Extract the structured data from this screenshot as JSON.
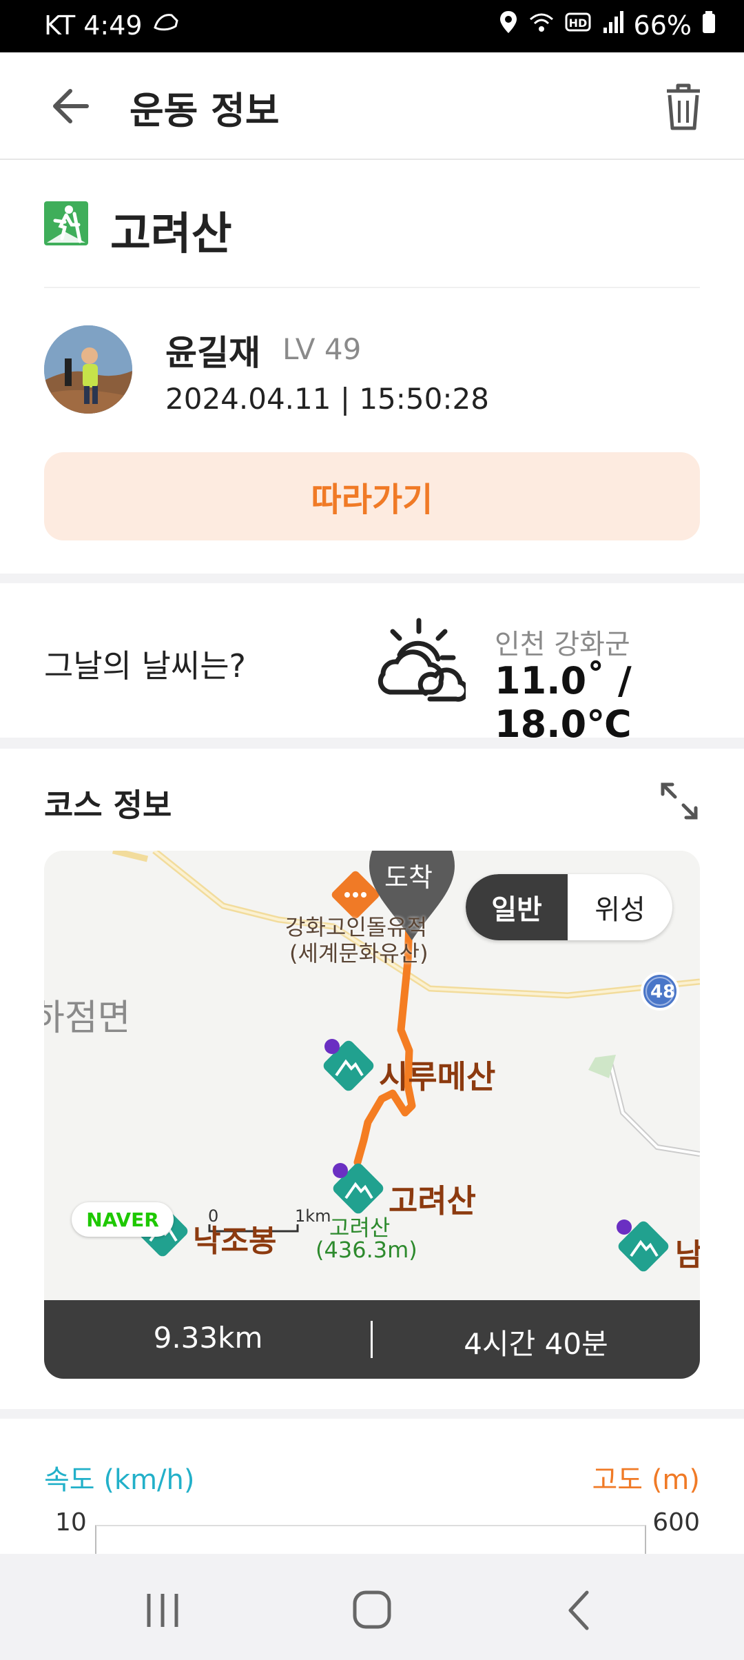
{
  "status_bar": {
    "carrier_time": "KT 4:49",
    "battery": "66%"
  },
  "app_bar": {
    "title": "운동 정보"
  },
  "activity": {
    "mountain": "고려산",
    "user_name": "윤길재",
    "level": "LV 49",
    "datetime": "2024.04.11 | 15:50:28",
    "follow_label": "따라가기"
  },
  "weather": {
    "question": "그날의 날씨는?",
    "location": "인천 강화군",
    "temperature": "11.0˚ / 18.0℃"
  },
  "course": {
    "title": "코스 정보",
    "map_toggle": {
      "normal": "일반",
      "satellite": "위성"
    },
    "map_labels": {
      "arrival": "도착",
      "heritage_1": "강화고인돌유적",
      "heritage_2": "(세계문화유산)",
      "region": "하점면",
      "peak_1": "시루메산",
      "peak_2": "고려산",
      "peak_2_small": "고려산",
      "peak_2_height": "(436.3m)",
      "peak_3": "낙조봉",
      "peak_4": "남",
      "route_no": "48",
      "scale_0": "0",
      "scale_1": "1km",
      "naver": "NAVER"
    },
    "distance": "9.33km",
    "duration": "4시간 40분"
  },
  "chart_header": {
    "speed_label": "속도 (km/h)",
    "altitude_label": "고도 (m)",
    "speed_max": "10",
    "altitude_max": "600"
  },
  "colors": {
    "accent": "#f07a26",
    "speed": "#22b0c9",
    "hike_icon": "#3fae5a"
  }
}
